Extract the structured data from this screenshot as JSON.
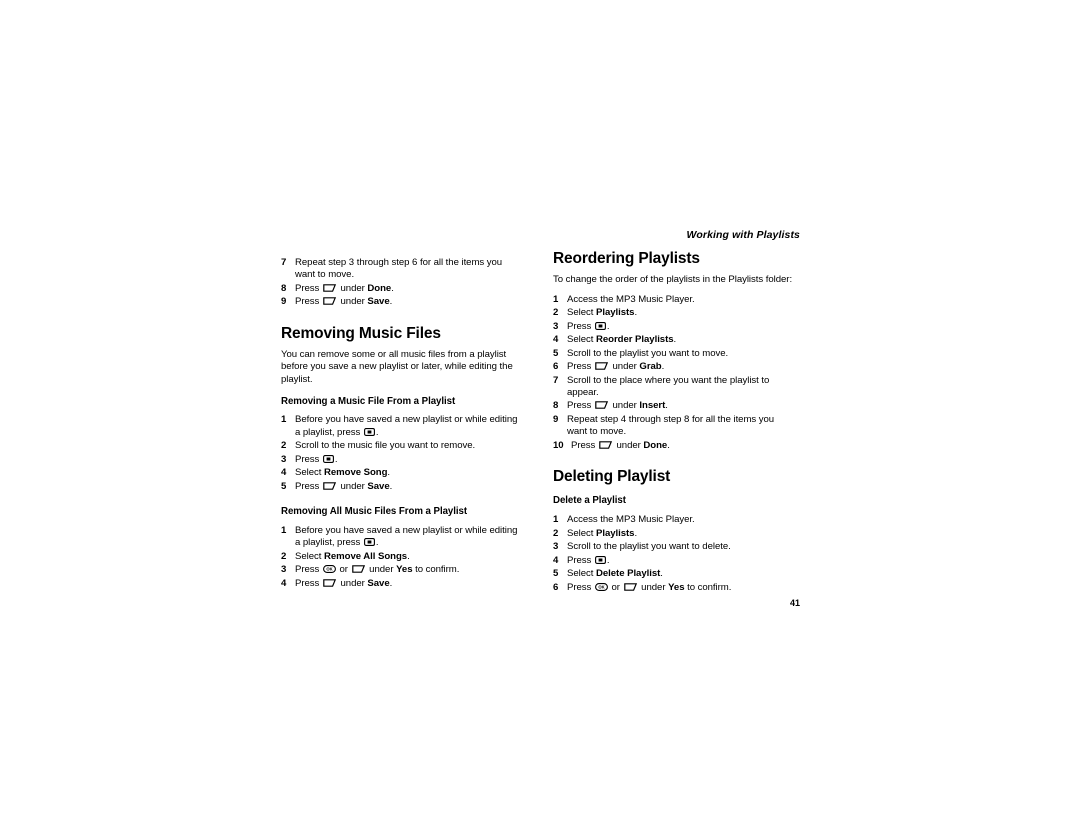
{
  "header": {
    "running_title": "Working with Playlists"
  },
  "folio": {
    "page_number": "41"
  },
  "icons": {
    "soft_key": "softkey-icon",
    "menu_key": "menu-key-icon",
    "ok_key": "ok-key-icon"
  },
  "left_column": {
    "continued_steps": [
      {
        "num": "7",
        "parts": [
          {
            "t": "Repeat step 3 through step 6 for all the items you want to move."
          }
        ]
      },
      {
        "num": "8",
        "parts": [
          {
            "t": "Press "
          },
          {
            "icon": "soft"
          },
          {
            "t": " under "
          },
          {
            "b": "Done"
          },
          {
            "t": "."
          }
        ]
      },
      {
        "num": "9",
        "parts": [
          {
            "t": "Press "
          },
          {
            "icon": "soft"
          },
          {
            "t": " under "
          },
          {
            "b": "Save"
          },
          {
            "t": "."
          }
        ]
      }
    ],
    "section": {
      "title": "Removing Music Files",
      "intro": "You can remove some or all music files from a playlist before you save a new playlist or later, while editing the playlist.",
      "subsections": [
        {
          "title": "Removing a Music File From a Playlist",
          "steps": [
            {
              "num": "1",
              "parts": [
                {
                  "t": "Before you have saved a new playlist or while editing a playlist, press "
                },
                {
                  "icon": "menu"
                },
                {
                  "t": "."
                }
              ]
            },
            {
              "num": "2",
              "parts": [
                {
                  "t": "Scroll to the music file you want to remove."
                }
              ]
            },
            {
              "num": "3",
              "parts": [
                {
                  "t": "Press "
                },
                {
                  "icon": "menu"
                },
                {
                  "t": "."
                }
              ]
            },
            {
              "num": "4",
              "parts": [
                {
                  "t": "Select "
                },
                {
                  "b": "Remove Song"
                },
                {
                  "t": "."
                }
              ]
            },
            {
              "num": "5",
              "parts": [
                {
                  "t": "Press "
                },
                {
                  "icon": "soft"
                },
                {
                  "t": " under "
                },
                {
                  "b": "Save"
                },
                {
                  "t": "."
                }
              ]
            }
          ]
        },
        {
          "title": "Removing All Music Files From a Playlist",
          "steps": [
            {
              "num": "1",
              "parts": [
                {
                  "t": "Before you have saved a new playlist or while editing a playlist, press "
                },
                {
                  "icon": "menu"
                },
                {
                  "t": "."
                }
              ]
            },
            {
              "num": "2",
              "parts": [
                {
                  "t": "Select "
                },
                {
                  "b": "Remove All Songs"
                },
                {
                  "t": "."
                }
              ]
            },
            {
              "num": "3",
              "parts": [
                {
                  "t": "Press "
                },
                {
                  "icon": "ok"
                },
                {
                  "t": " or "
                },
                {
                  "icon": "soft"
                },
                {
                  "t": " under "
                },
                {
                  "b": "Yes"
                },
                {
                  "t": " to confirm."
                }
              ]
            },
            {
              "num": "4",
              "parts": [
                {
                  "t": "Press "
                },
                {
                  "icon": "soft"
                },
                {
                  "t": " under "
                },
                {
                  "b": "Save"
                },
                {
                  "t": "."
                }
              ]
            }
          ]
        }
      ]
    }
  },
  "right_column": {
    "sections": [
      {
        "title": "Reordering Playlists",
        "intro": "To change the order of the playlists in the Playlists folder:",
        "steps": [
          {
            "num": "1",
            "parts": [
              {
                "t": "Access the MP3 Music Player."
              }
            ]
          },
          {
            "num": "2",
            "parts": [
              {
                "t": "Select "
              },
              {
                "b": "Playlists"
              },
              {
                "t": "."
              }
            ]
          },
          {
            "num": "3",
            "parts": [
              {
                "t": "Press "
              },
              {
                "icon": "menu"
              },
              {
                "t": "."
              }
            ]
          },
          {
            "num": "4",
            "parts": [
              {
                "t": "Select "
              },
              {
                "b": "Reorder Playlists"
              },
              {
                "t": "."
              }
            ]
          },
          {
            "num": "5",
            "parts": [
              {
                "t": "Scroll to the playlist you want to move."
              }
            ]
          },
          {
            "num": "6",
            "parts": [
              {
                "t": "Press "
              },
              {
                "icon": "soft"
              },
              {
                "t": " under "
              },
              {
                "b": "Grab"
              },
              {
                "t": "."
              }
            ]
          },
          {
            "num": "7",
            "parts": [
              {
                "t": "Scroll to the place where you want the playlist to appear."
              }
            ]
          },
          {
            "num": "8",
            "parts": [
              {
                "t": "Press "
              },
              {
                "icon": "soft"
              },
              {
                "t": " under "
              },
              {
                "b": "Insert"
              },
              {
                "t": "."
              }
            ]
          },
          {
            "num": "9",
            "parts": [
              {
                "t": "Repeat step 4 through step 8 for all the items you want to move."
              }
            ]
          },
          {
            "num": "10",
            "wide": true,
            "parts": [
              {
                "t": "Press "
              },
              {
                "icon": "soft"
              },
              {
                "t": " under "
              },
              {
                "b": "Done"
              },
              {
                "t": "."
              }
            ]
          }
        ]
      },
      {
        "title": "Deleting Playlist",
        "subsections": [
          {
            "title": "Delete a Playlist",
            "steps": [
              {
                "num": "1",
                "parts": [
                  {
                    "t": "Access the MP3 Music Player."
                  }
                ]
              },
              {
                "num": "2",
                "parts": [
                  {
                    "t": "Select "
                  },
                  {
                    "b": "Playlists"
                  },
                  {
                    "t": "."
                  }
                ]
              },
              {
                "num": "3",
                "parts": [
                  {
                    "t": "Scroll to the playlist you want to delete."
                  }
                ]
              },
              {
                "num": "4",
                "parts": [
                  {
                    "t": "Press "
                  },
                  {
                    "icon": "menu"
                  },
                  {
                    "t": "."
                  }
                ]
              },
              {
                "num": "5",
                "parts": [
                  {
                    "t": "Select "
                  },
                  {
                    "b": "Delete Playlist"
                  },
                  {
                    "t": "."
                  }
                ]
              },
              {
                "num": "6",
                "parts": [
                  {
                    "t": "Press "
                  },
                  {
                    "icon": "ok"
                  },
                  {
                    "t": " or "
                  },
                  {
                    "icon": "soft"
                  },
                  {
                    "t": " under "
                  },
                  {
                    "b": "Yes"
                  },
                  {
                    "t": " to confirm."
                  }
                ]
              }
            ]
          }
        ]
      }
    ]
  }
}
